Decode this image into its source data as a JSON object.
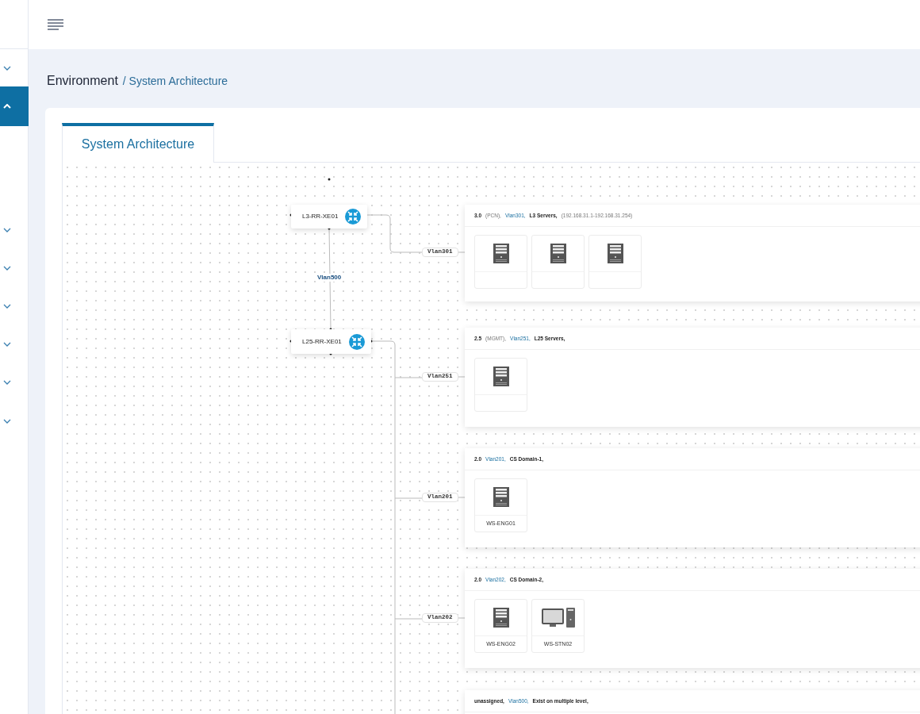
{
  "sidebar": {
    "items": [
      {
        "expanded": false,
        "selected": false
      },
      {
        "expanded": true,
        "selected": true
      },
      {
        "expanded": false,
        "selected": false
      },
      {
        "expanded": false,
        "selected": false
      },
      {
        "expanded": false,
        "selected": false
      },
      {
        "expanded": false,
        "selected": false
      },
      {
        "expanded": false,
        "selected": false
      },
      {
        "expanded": false,
        "selected": false
      }
    ]
  },
  "breadcrumb": {
    "root": "Environment",
    "current": "/ System Architecture"
  },
  "tabs": [
    {
      "label": "System Architecture",
      "selected": true
    }
  ],
  "diagram": {
    "routers": [
      {
        "name": "L3-RR-XE01"
      },
      {
        "name": "L25-RR-XE01"
      }
    ],
    "uplink_label": "Vlan500",
    "vlan_labels": [
      "Vlan301",
      "Vlan251",
      "Vlan201",
      "Vlan202"
    ],
    "groups": [
      {
        "segments": [
          {
            "kind": "strong",
            "text": "3.0"
          },
          {
            "kind": "muted",
            "text": "(PCN),"
          },
          {
            "kind": "link",
            "text": "Vlan301,"
          },
          {
            "kind": "strong",
            "text": "L3 Servers,"
          },
          {
            "kind": "muted",
            "text": "(192.168.31.1-192.168.31.254)"
          }
        ],
        "devices": [
          {
            "kind": "server"
          },
          {
            "kind": "server"
          },
          {
            "kind": "server"
          }
        ]
      },
      {
        "segments": [
          {
            "kind": "strong",
            "text": "2.5"
          },
          {
            "kind": "muted",
            "text": "(MGMT),"
          },
          {
            "kind": "link",
            "text": "Vlan251,"
          },
          {
            "kind": "strong",
            "text": "L25 Servers,"
          }
        ],
        "devices": [
          {
            "kind": "server"
          }
        ]
      },
      {
        "segments": [
          {
            "kind": "strong",
            "text": "2.0"
          },
          {
            "kind": "link",
            "text": "Vlan201,"
          },
          {
            "kind": "strong",
            "text": "CS Domain-1,"
          }
        ],
        "devices": [
          {
            "kind": "server",
            "label": "WS-ENG01"
          }
        ]
      },
      {
        "segments": [
          {
            "kind": "strong",
            "text": "2.0"
          },
          {
            "kind": "link",
            "text": "Vlan202,"
          },
          {
            "kind": "strong",
            "text": "CS Domain-2,"
          }
        ],
        "devices": [
          {
            "kind": "server",
            "label": "WS-ENG02"
          },
          {
            "kind": "workstation",
            "label": "WS-STN02"
          }
        ]
      },
      {
        "segments": [
          {
            "kind": "strong",
            "text": "unassigned,"
          },
          {
            "kind": "link",
            "text": "Vlan500,"
          },
          {
            "kind": "strong",
            "text": "Exist on multiple level,"
          }
        ]
      }
    ]
  }
}
